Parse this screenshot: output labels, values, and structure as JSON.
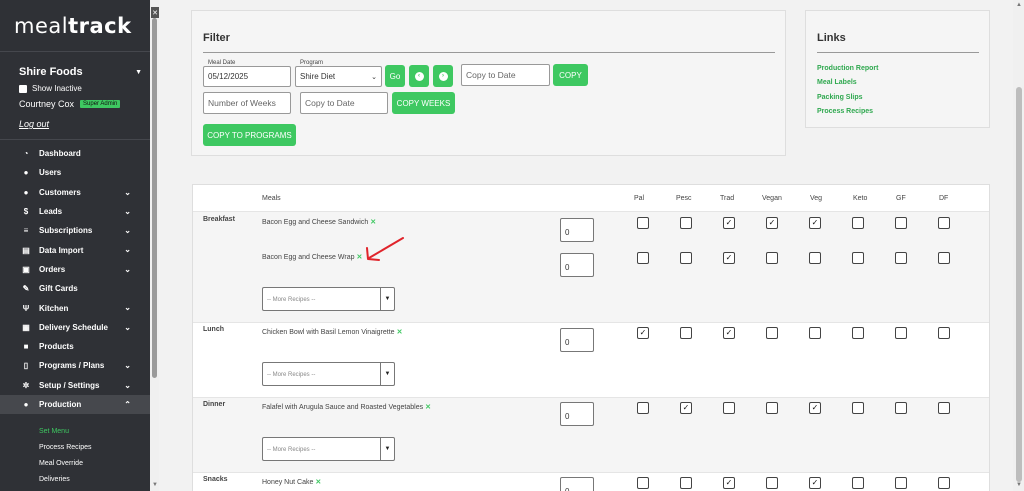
{
  "brand": {
    "logo_light": "meal",
    "logo_bold": "track",
    "accent": "#3ec861"
  },
  "sidebar": {
    "org_name": "Shire Foods",
    "show_inactive": "Show Inactive",
    "user_name": "Courtney Cox",
    "user_badge": "Super Admin",
    "logout": "Log out",
    "nav": [
      {
        "label": "Dashboard",
        "icon": "speedometer-icon"
      },
      {
        "label": "Users",
        "icon": "user-icon"
      },
      {
        "label": "Customers",
        "icon": "users-icon"
      },
      {
        "label": "Leads",
        "icon": "dollar-icon"
      },
      {
        "label": "Subscriptions",
        "icon": "layers-icon"
      },
      {
        "label": "Data Import",
        "icon": "file-icon"
      },
      {
        "label": "Orders",
        "icon": "cart-icon"
      },
      {
        "label": "Gift Cards",
        "icon": "wrench-icon"
      },
      {
        "label": "Kitchen",
        "icon": "utensils-icon"
      },
      {
        "label": "Delivery Schedule",
        "icon": "calendar-icon"
      },
      {
        "label": "Products",
        "icon": "box-icon"
      },
      {
        "label": "Programs / Plans",
        "icon": "clipboard-icon"
      },
      {
        "label": "Setup / Settings",
        "icon": "gear-icon"
      },
      {
        "label": "Production",
        "icon": "person-icon"
      }
    ],
    "subnav": [
      "Set Menu",
      "Process Recipes",
      "Meal Override",
      "Deliveries"
    ]
  },
  "filter": {
    "title": "Filter",
    "meal_date_label": "Meal Date",
    "meal_date_value": "05/12/2025",
    "program_label": "Program",
    "program_value": "Shire Diet",
    "go": "Go",
    "copy_to_date_placeholder": "Copy to Date",
    "copy": "COPY",
    "number_of_weeks_placeholder": "Number of Weeks",
    "copy_to_date2_placeholder": "Copy to Date",
    "copy_weeks": "COPY WEEKS",
    "copy_to_programs": "COPY TO PROGRAMS"
  },
  "links": {
    "title": "Links",
    "items": [
      "Production Report",
      "Meal Labels",
      "Packing Slips",
      "Process Recipes"
    ]
  },
  "table": {
    "meals_header": "Meals",
    "diet_headers": [
      "Pal",
      "Pesc",
      "Trad",
      "Vegan",
      "Veg",
      "Keto",
      "GF",
      "DF"
    ],
    "more_placeholder": "-- More Recipes --",
    "rows": [
      {
        "type": "Breakfast",
        "meal": "Bacon Egg and Cheese Sandwich",
        "qty": "0",
        "checks": [
          false,
          false,
          true,
          true,
          true,
          false,
          false,
          false
        ]
      },
      {
        "type": "",
        "meal": "Bacon Egg and Cheese Wrap",
        "qty": "0",
        "checks": [
          false,
          false,
          true,
          false,
          false,
          false,
          false,
          false
        ]
      },
      {
        "type": "Lunch",
        "meal": "Chicken Bowl with Basil Lemon Vinaigrette",
        "qty": "0",
        "checks": [
          true,
          false,
          true,
          false,
          false,
          false,
          false,
          false
        ]
      },
      {
        "type": "Dinner",
        "meal": "Falafel with Arugula Sauce and Roasted Vegetables",
        "qty": "0",
        "checks": [
          false,
          true,
          false,
          false,
          true,
          false,
          false,
          false
        ]
      },
      {
        "type": "Snacks",
        "meal": "Honey Nut Cake",
        "qty": "0",
        "checks": [
          false,
          false,
          true,
          false,
          true,
          false,
          false,
          false
        ]
      }
    ]
  }
}
